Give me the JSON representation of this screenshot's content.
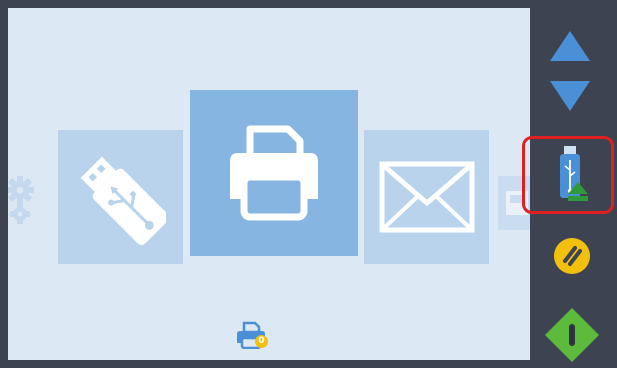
{
  "screen": {
    "tiles": [
      {
        "id": "settings",
        "icon": "gear-icon"
      },
      {
        "id": "usb",
        "icon": "usb-stick-icon"
      },
      {
        "id": "print",
        "icon": "printer-icon",
        "selected": true
      },
      {
        "id": "email",
        "icon": "envelope-icon"
      },
      {
        "id": "fax",
        "icon": "fax-icon"
      }
    ],
    "status": {
      "icon": "printer-status-icon",
      "job_count": "0"
    }
  },
  "sidebar": {
    "buttons": [
      {
        "id": "up",
        "icon": "triangle-up-icon",
        "color": "#4a90d6"
      },
      {
        "id": "down",
        "icon": "triangle-down-icon",
        "color": "#4a90d6"
      },
      {
        "id": "usb-eject",
        "icon": "usb-eject-icon",
        "highlighted": true,
        "highlight_color": "#e02020"
      },
      {
        "id": "stop",
        "icon": "stop-icon",
        "color": "#f2c10e"
      },
      {
        "id": "start",
        "icon": "start-icon",
        "color": "#5dbb3c"
      }
    ]
  },
  "colors": {
    "frame": "#3d4350",
    "screen_bg": "#dde8f5",
    "tile_selected": "#86b5e2",
    "tile_normal": "#b9d3ed"
  }
}
